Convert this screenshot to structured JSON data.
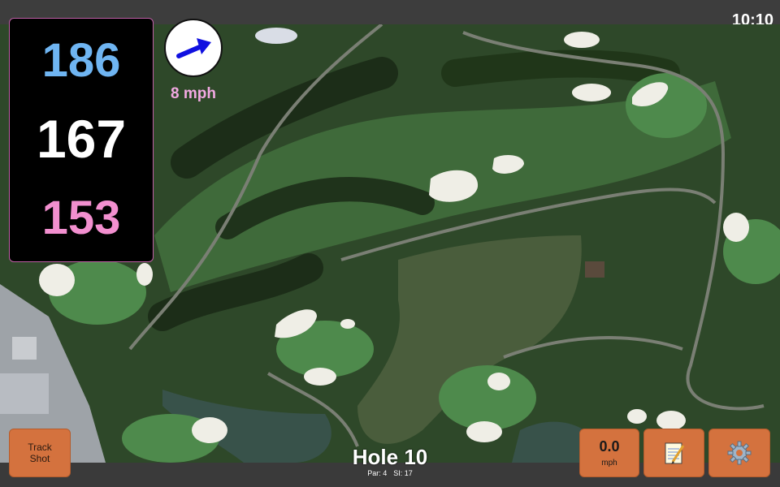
{
  "status": {
    "time": "10:10"
  },
  "distances": {
    "back": "186",
    "middle": "167",
    "front": "153"
  },
  "wind": {
    "speed_label": "8 mph",
    "direction_icon": "arrow-right-icon"
  },
  "hole": {
    "title": "Hole 10",
    "par": "Par: 4",
    "si": "SI: 17"
  },
  "buttons": {
    "track_shot_line1": "Track",
    "track_shot_line2": "Shot",
    "wind_value": "0.0",
    "wind_unit": "mph",
    "notes_icon": "notepad-icon",
    "settings_icon": "gear-icon"
  },
  "colors": {
    "back_distance": "#6fb5f2",
    "middle_distance": "#ffffff",
    "front_distance": "#f28fcf",
    "button_orange": "#d4723e",
    "wind_arrow": "#1010e0"
  }
}
